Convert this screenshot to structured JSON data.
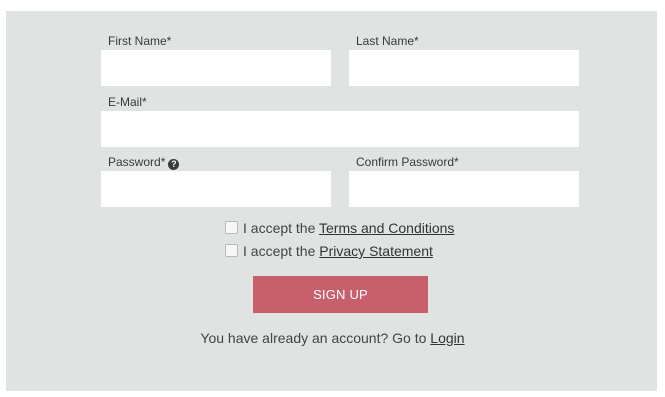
{
  "form": {
    "first_name": {
      "label": "First Name*",
      "value": "",
      "placeholder": ""
    },
    "last_name": {
      "label": "Last Name*",
      "value": "",
      "placeholder": ""
    },
    "email": {
      "label": "E-Mail*",
      "value": "",
      "placeholder": ""
    },
    "password": {
      "label": "Password*",
      "value": "",
      "placeholder": ""
    },
    "confirm_password": {
      "label": "Confirm Password*",
      "value": "",
      "placeholder": ""
    },
    "help_icon": "question-circle-icon"
  },
  "consents": {
    "terms": {
      "prefix": "I accept the ",
      "link_text": "Terms and Conditions",
      "checked": false
    },
    "privacy": {
      "prefix": "I accept the ",
      "link_text": "Privacy Statement",
      "checked": false
    }
  },
  "signup_button": {
    "label": "SIGN UP"
  },
  "login_prompt": {
    "text": "You have already an account? Go to ",
    "link_text": "Login"
  },
  "colors": {
    "panel_bg": "#dfe3e2",
    "button_bg": "#c8606c",
    "input_bg": "#ffffff"
  }
}
